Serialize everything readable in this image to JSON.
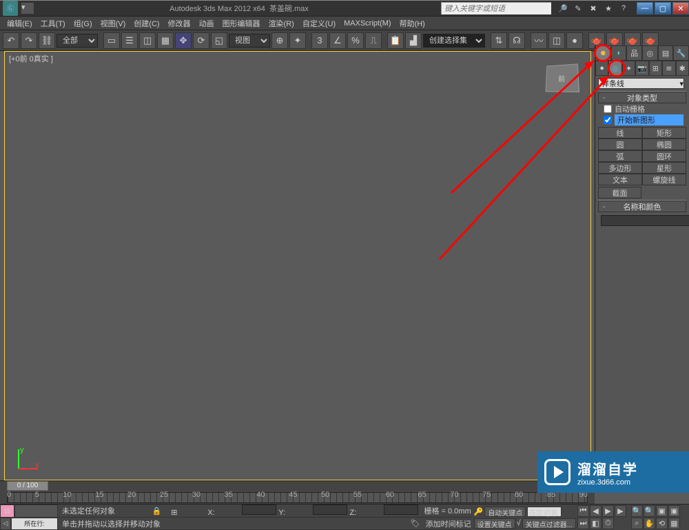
{
  "title": {
    "app": "Autodesk 3ds Max 2012 x64",
    "file": "茶盖碗.max"
  },
  "search_placeholder": "键入关键字或短语",
  "menu": [
    "编辑(E)",
    "工具(T)",
    "组(G)",
    "视图(V)",
    "创建(C)",
    "修改器",
    "动画",
    "图形编辑器",
    "渲染(R)",
    "自定义(U)",
    "MAXScript(M)",
    "帮助(H)"
  ],
  "toolbar": {
    "layer_sel": "全部",
    "view_sel": "视图",
    "selset": "创建选择集"
  },
  "viewport": {
    "label": "[+0前 0真实 ]",
    "cube_face": "前"
  },
  "cmdpanel": {
    "dropdown": "样条线",
    "rollout_objtype": "对象类型",
    "auto_grid": "自动栅格",
    "start_new": "开始新图形",
    "buttons": [
      [
        "线",
        "矩形"
      ],
      [
        "圆",
        "椭圆"
      ],
      [
        "弧",
        "圆环"
      ],
      [
        "多边形",
        "星形"
      ],
      [
        "文本",
        "螺旋线"
      ],
      [
        "截面",
        ""
      ]
    ],
    "rollout_namecolor": "名称和颜色"
  },
  "time": {
    "slider": "0 / 100",
    "ticks": [
      "0",
      "5",
      "10",
      "15",
      "20",
      "25",
      "30",
      "35",
      "40",
      "45",
      "50",
      "55",
      "60",
      "65",
      "70",
      "75",
      "80",
      "85",
      "90"
    ]
  },
  "status": {
    "row_val": "所在行:",
    "no_sel": "未选定任何对象",
    "hint": "单击并拖动以选择并移动对象",
    "add_time": "添加时间标记",
    "coord_x": "X:",
    "coord_y": "Y:",
    "coord_z": "Z:",
    "grid_label": "栅格 = 0.0mm",
    "autokey": "自动关键点",
    "setkey": "设置关键点",
    "selset_label": "选定对象",
    "keyfilter": "关键点过滤器..."
  },
  "watermark": {
    "brand": "溜溜自学",
    "url": "zixue.3d66.com"
  }
}
